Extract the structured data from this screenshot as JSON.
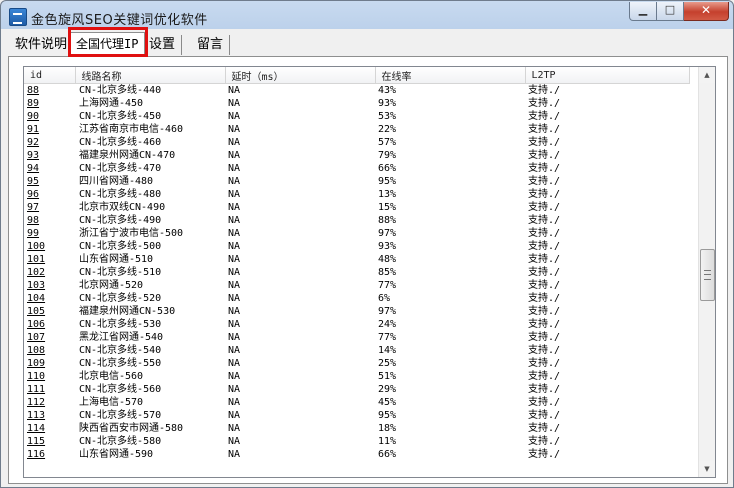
{
  "window": {
    "title": "金色旋风SEO关键词优化软件",
    "min_glyph": "▁",
    "max_glyph": "□",
    "close_glyph": "✕"
  },
  "tabs": [
    {
      "label": "软件说明"
    },
    {
      "label": "全国代理IP"
    },
    {
      "label": "设置"
    },
    {
      "label": "留言"
    }
  ],
  "table": {
    "columns": [
      "id",
      "线路名称",
      "延时（ms）",
      "在线率",
      "L2TP"
    ],
    "rows": [
      [
        "88",
        "CN-北京多线-440",
        "NA",
        "43%",
        "支持./"
      ],
      [
        "89",
        "上海网通-450",
        "NA",
        "93%",
        "支持./"
      ],
      [
        "90",
        "CN-北京多线-450",
        "NA",
        "53%",
        "支持./"
      ],
      [
        "91",
        "江苏省南京市电信-460",
        "NA",
        "22%",
        "支持./"
      ],
      [
        "92",
        "CN-北京多线-460",
        "NA",
        "57%",
        "支持./"
      ],
      [
        "93",
        "福建泉州网通CN-470",
        "NA",
        "79%",
        "支持./"
      ],
      [
        "94",
        "CN-北京多线-470",
        "NA",
        "66%",
        "支持./"
      ],
      [
        "95",
        "四川省网通-480",
        "NA",
        "95%",
        "支持./"
      ],
      [
        "96",
        "CN-北京多线-480",
        "NA",
        "13%",
        "支持./"
      ],
      [
        "97",
        "北京市双线CN-490",
        "NA",
        "15%",
        "支持./"
      ],
      [
        "98",
        "CN-北京多线-490",
        "NA",
        "88%",
        "支持./"
      ],
      [
        "99",
        "浙江省宁波市电信-500",
        "NA",
        "97%",
        "支持./"
      ],
      [
        "100",
        "CN-北京多线-500",
        "NA",
        "93%",
        "支持./"
      ],
      [
        "101",
        "山东省网通-510",
        "NA",
        "48%",
        "支持./"
      ],
      [
        "102",
        "CN-北京多线-510",
        "NA",
        "85%",
        "支持./"
      ],
      [
        "103",
        "北京网通-520",
        "NA",
        "77%",
        "支持./"
      ],
      [
        "104",
        "CN-北京多线-520",
        "NA",
        "6%",
        "支持./"
      ],
      [
        "105",
        "福建泉州网通CN-530",
        "NA",
        "97%",
        "支持./"
      ],
      [
        "106",
        "CN-北京多线-530",
        "NA",
        "24%",
        "支持./"
      ],
      [
        "107",
        "黑龙江省网通-540",
        "NA",
        "77%",
        "支持./"
      ],
      [
        "108",
        "CN-北京多线-540",
        "NA",
        "14%",
        "支持./"
      ],
      [
        "109",
        "CN-北京多线-550",
        "NA",
        "25%",
        "支持./"
      ],
      [
        "110",
        "北京电信-560",
        "NA",
        "51%",
        "支持./"
      ],
      [
        "111",
        "CN-北京多线-560",
        "NA",
        "29%",
        "支持./"
      ],
      [
        "112",
        "上海电信-570",
        "NA",
        "45%",
        "支持./"
      ],
      [
        "113",
        "CN-北京多线-570",
        "NA",
        "95%",
        "支持./"
      ],
      [
        "114",
        "陕西省西安市网通-580",
        "NA",
        "18%",
        "支持./"
      ],
      [
        "115",
        "CN-北京多线-580",
        "NA",
        "11%",
        "支持./"
      ],
      [
        "116",
        "山东省网通-590",
        "NA",
        "66%",
        "支持./"
      ]
    ]
  },
  "scrollbar": {
    "up_glyph": "▲",
    "down_glyph": "▼"
  },
  "colors": {
    "highlight": "#e01010",
    "title_bar": "#c8daef",
    "close_button": "#c5402d"
  }
}
